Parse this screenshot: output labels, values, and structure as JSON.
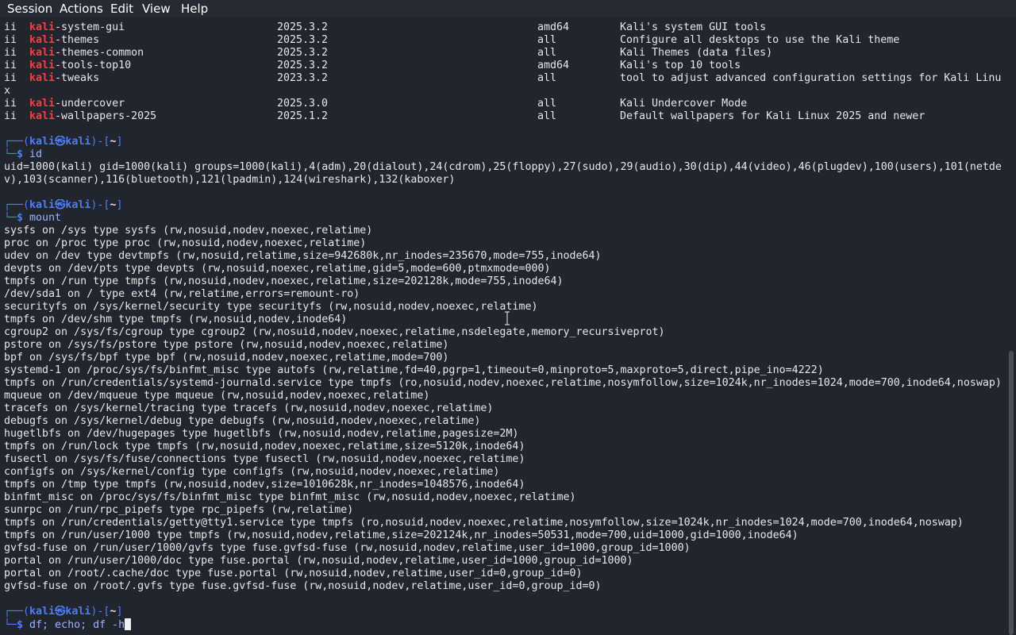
{
  "menubar": {
    "items": [
      "Session",
      "Actions",
      "Edit",
      "View",
      "Help"
    ]
  },
  "prompt": {
    "prefix": "┌──(",
    "user": "kali",
    "at_symbol": "㉿",
    "host": "kali",
    "mid": ")-[",
    "path": "~",
    "suffix": "]",
    "second_line": "└─",
    "dollar": "$ "
  },
  "packages": [
    {
      "status": "ii",
      "name_hl": "kali",
      "name_rest": "-system-gui",
      "version": "2025.3.2",
      "arch": "amd64",
      "desc": "Kali's system GUI tools"
    },
    {
      "status": "ii",
      "name_hl": "kali",
      "name_rest": "-themes",
      "version": "2025.3.2",
      "arch": "all",
      "desc": "Configure all desktops to use the Kali theme"
    },
    {
      "status": "ii",
      "name_hl": "kali",
      "name_rest": "-themes-common",
      "version": "2025.3.2",
      "arch": "all",
      "desc": "Kali Themes (data files)"
    },
    {
      "status": "ii",
      "name_hl": "kali",
      "name_rest": "-tools-top10",
      "version": "2025.3.2",
      "arch": "amd64",
      "desc": "Kali's top 10 tools"
    },
    {
      "status": "ii",
      "name_hl": "kali",
      "name_rest": "-tweaks",
      "version": "2023.3.2",
      "arch": "all",
      "desc": "tool to adjust advanced configuration settings for Kali Linu"
    }
  ],
  "wrap_after_tweaks": "x",
  "packages2": [
    {
      "status": "ii",
      "name_hl": "kali",
      "name_rest": "-undercover",
      "version": "2025.3.0",
      "arch": "all",
      "desc": "Kali Undercover Mode"
    },
    {
      "status": "ii",
      "name_hl": "kali",
      "name_rest": "-wallpapers-2025",
      "version": "2025.1.2",
      "arch": "all",
      "desc": "Default wallpapers for Kali Linux 2025 and newer"
    }
  ],
  "commands": {
    "id": "id",
    "mount": "mount",
    "current": "df; echo; df -h"
  },
  "id_output": [
    "uid=1000(kali) gid=1000(kali) groups=1000(kali),4(adm),20(dialout),24(cdrom),25(floppy),27(sudo),29(audio),30(dip),44(video),46(plugdev),100(users),101(netde",
    "v),103(scanner),116(bluetooth),121(lpadmin),124(wireshark),132(kaboxer)"
  ],
  "mount_output": [
    "sysfs on /sys type sysfs (rw,nosuid,nodev,noexec,relatime)",
    "proc on /proc type proc (rw,nosuid,nodev,noexec,relatime)",
    "udev on /dev type devtmpfs (rw,nosuid,relatime,size=942680k,nr_inodes=235670,mode=755,inode64)",
    "devpts on /dev/pts type devpts (rw,nosuid,noexec,relatime,gid=5,mode=600,ptmxmode=000)",
    "tmpfs on /run type tmpfs (rw,nosuid,nodev,noexec,relatime,size=202128k,mode=755,inode64)",
    "/dev/sda1 on / type ext4 (rw,relatime,errors=remount-ro)",
    "securityfs on /sys/kernel/security type securityfs (rw,nosuid,nodev,noexec,relatime)",
    "tmpfs on /dev/shm type tmpfs (rw,nosuid,nodev,inode64)",
    "cgroup2 on /sys/fs/cgroup type cgroup2 (rw,nosuid,nodev,noexec,relatime,nsdelegate,memory_recursiveprot)",
    "pstore on /sys/fs/pstore type pstore (rw,nosuid,nodev,noexec,relatime)",
    "bpf on /sys/fs/bpf type bpf (rw,nosuid,nodev,noexec,relatime,mode=700)",
    "systemd-1 on /proc/sys/fs/binfmt_misc type autofs (rw,relatime,fd=40,pgrp=1,timeout=0,minproto=5,maxproto=5,direct,pipe_ino=4222)",
    "tmpfs on /run/credentials/systemd-journald.service type tmpfs (ro,nosuid,nodev,noexec,relatime,nosymfollow,size=1024k,nr_inodes=1024,mode=700,inode64,noswap)",
    "mqueue on /dev/mqueue type mqueue (rw,nosuid,nodev,noexec,relatime)",
    "tracefs on /sys/kernel/tracing type tracefs (rw,nosuid,nodev,noexec,relatime)",
    "debugfs on /sys/kernel/debug type debugfs (rw,nosuid,nodev,noexec,relatime)",
    "hugetlbfs on /dev/hugepages type hugetlbfs (rw,nosuid,nodev,relatime,pagesize=2M)",
    "tmpfs on /run/lock type tmpfs (rw,nosuid,nodev,noexec,relatime,size=5120k,inode64)",
    "fusectl on /sys/fs/fuse/connections type fusectl (rw,nosuid,nodev,noexec,relatime)",
    "configfs on /sys/kernel/config type configfs (rw,nosuid,nodev,noexec,relatime)",
    "tmpfs on /tmp type tmpfs (rw,nosuid,nodev,size=1010628k,nr_inodes=1048576,inode64)",
    "binfmt_misc on /proc/sys/fs/binfmt_misc type binfmt_misc (rw,nosuid,nodev,noexec,relatime)",
    "sunrpc on /run/rpc_pipefs type rpc_pipefs (rw,relatime)",
    "tmpfs on /run/credentials/getty@tty1.service type tmpfs (ro,nosuid,nodev,noexec,relatime,nosymfollow,size=1024k,nr_inodes=1024,mode=700,inode64,noswap)",
    "tmpfs on /run/user/1000 type tmpfs (rw,nosuid,nodev,relatime,size=202124k,nr_inodes=50531,mode=700,uid=1000,gid=1000,inode64)",
    "gvfsd-fuse on /run/user/1000/gvfs type fuse.gvfsd-fuse (rw,nosuid,nodev,relatime,user_id=1000,group_id=1000)",
    "portal on /run/user/1000/doc type fuse.portal (rw,nosuid,nodev,relatime,user_id=1000,group_id=1000)",
    "portal on /root/.cache/doc type fuse.portal (rw,nosuid,nodev,relatime,user_id=0,group_id=0)",
    "gvfsd-fuse on /root/.gvfs type fuse.gvfsd-fuse (rw,nosuid,nodev,relatime,user_id=0,group_id=0)"
  ],
  "scrollbar": {
    "visible_fraction": 0.46,
    "position_fraction": 1.0
  },
  "colors": {
    "background": "#20252e",
    "menubar": "#262a33",
    "kali_highlight": "#ff3c3c",
    "prompt_blue": "#4d7cff",
    "command_text": "#9db4ff"
  }
}
